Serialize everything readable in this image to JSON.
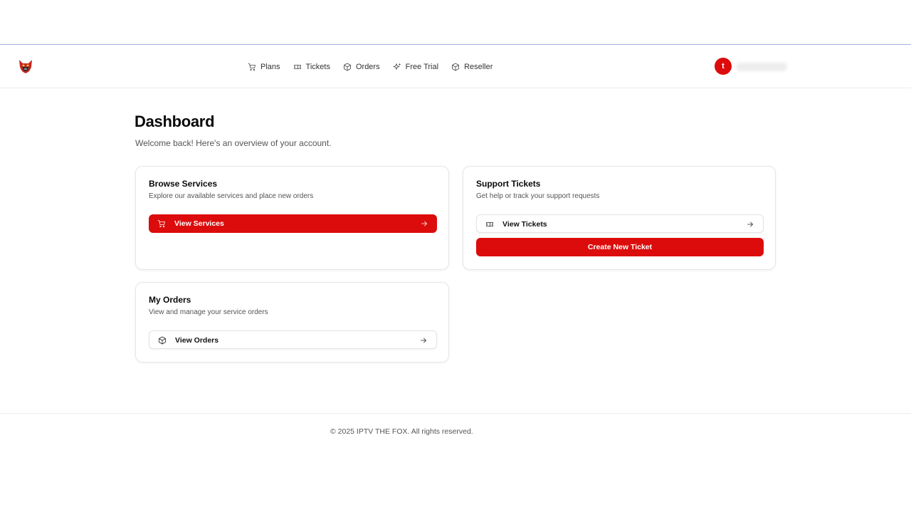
{
  "header": {
    "logo_icon": "fox-logo-icon",
    "nav": [
      {
        "label": "Plans",
        "icon": "cart-icon"
      },
      {
        "label": "Tickets",
        "icon": "ticket-icon"
      },
      {
        "label": "Orders",
        "icon": "package-icon"
      },
      {
        "label": "Free Trial",
        "icon": "sparkles-icon"
      },
      {
        "label": "Reseller",
        "icon": "package-icon"
      }
    ],
    "user": {
      "avatar_initial": "t"
    }
  },
  "main": {
    "title": "Dashboard",
    "subtitle": "Welcome back! Here's an overview of your account.",
    "cards": {
      "browse": {
        "title": "Browse Services",
        "description": "Explore our available services and place new orders",
        "button_label": "View Services"
      },
      "support": {
        "title": "Support Tickets",
        "description": "Get help or track your support requests",
        "button_label": "View Tickets",
        "secondary_button_label": "Create New Ticket"
      },
      "orders": {
        "title": "My Orders",
        "description": "View and manage your service orders",
        "button_label": "View Orders"
      }
    }
  },
  "footer": {
    "copyright": "© 2025 IPTV THE FOX. All rights reserved."
  },
  "colors": {
    "accent": "#dc0c0c",
    "text": "#0a0a0a",
    "muted": "#555555",
    "border": "#e6e6e6"
  }
}
